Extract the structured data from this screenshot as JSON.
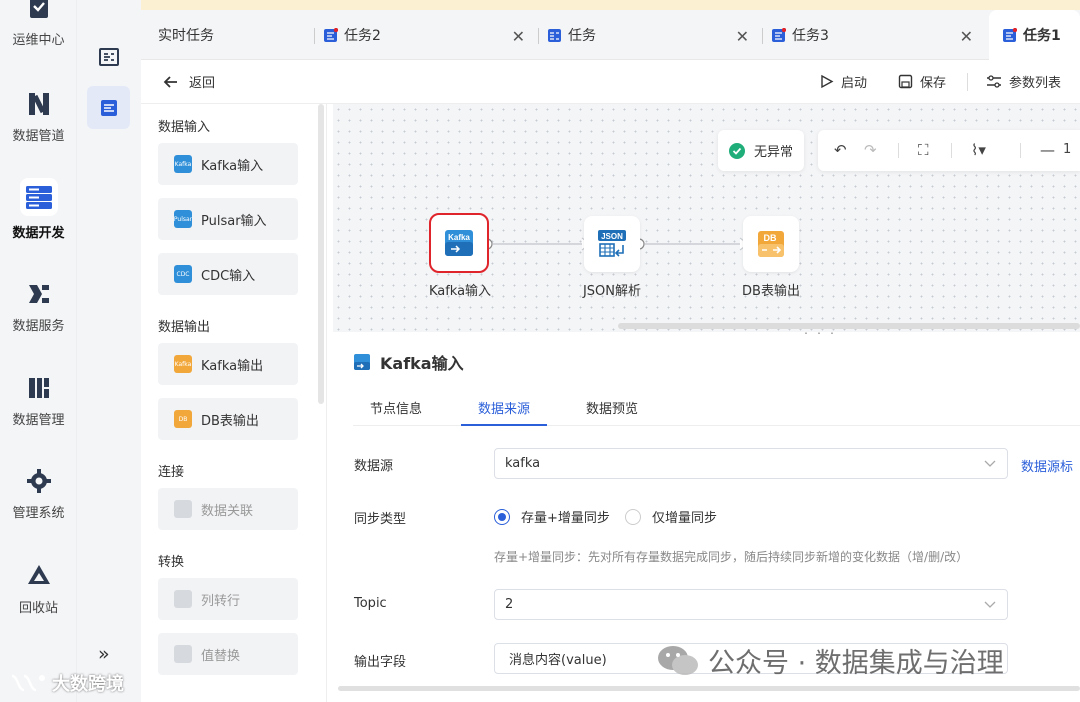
{
  "colors": {
    "accent": "#2b5fd9",
    "selected_outline": "#e0242b",
    "success": "#1fae7a",
    "kafka_icon": "#2f8fd8",
    "db_icon": "#f2a73a"
  },
  "nav": {
    "items": [
      {
        "label": "运维中心",
        "icon": "ops-center-icon"
      },
      {
        "label": "数据管道",
        "icon": "data-pipeline-icon"
      },
      {
        "label": "数据开发",
        "icon": "data-dev-icon",
        "active": true
      },
      {
        "label": "数据服务",
        "icon": "data-service-icon"
      },
      {
        "label": "数据管理",
        "icon": "data-management-icon"
      },
      {
        "label": "管理系统",
        "icon": "gear-icon"
      },
      {
        "label": "回收站",
        "icon": "recycle-bin-icon"
      }
    ],
    "collapse_glyph": "»"
  },
  "tabs": {
    "items": [
      {
        "label": "实时任务"
      },
      {
        "label": "任务2",
        "closable": true
      },
      {
        "label": "任务",
        "closable": true
      },
      {
        "label": "任务3",
        "closable": true
      },
      {
        "label": "任务1",
        "active": true
      }
    ]
  },
  "toolbar": {
    "back": "返回",
    "start": "启动",
    "save": "保存",
    "params": "参数列表"
  },
  "palette": {
    "groups": [
      {
        "title": "数据输入",
        "items": [
          {
            "label": "Kafka输入"
          },
          {
            "label": "Pulsar输入"
          },
          {
            "label": "CDC输入"
          }
        ]
      },
      {
        "title": "数据输出",
        "items": [
          {
            "label": "Kafka输出"
          },
          {
            "label": "DB表输出"
          }
        ]
      },
      {
        "title": "连接",
        "items": [
          {
            "label": "数据关联",
            "disabled": true
          }
        ]
      },
      {
        "title": "转换",
        "items": [
          {
            "label": "列转行",
            "disabled": true
          },
          {
            "label": "值替换",
            "disabled": true
          }
        ]
      }
    ],
    "icon_text": {
      "kafka": "Kafka",
      "pulsar": "Pulsar",
      "cdc": "CDC",
      "db": "DB"
    }
  },
  "canvas": {
    "status": "无异常",
    "zoom_label": "1",
    "nodes": [
      {
        "label": "Kafka输入",
        "icon": "kafka-icon",
        "badge": "Kafka",
        "selected": true
      },
      {
        "label": "JSON解析",
        "icon": "json-icon",
        "badge": "JSON"
      },
      {
        "label": "DB表输出",
        "icon": "db-icon",
        "badge": "DB"
      }
    ]
  },
  "detail": {
    "title": "Kafka输入",
    "tabs": [
      {
        "label": "节点信息"
      },
      {
        "label": "数据来源",
        "active": true
      },
      {
        "label": "数据预览"
      }
    ],
    "form": {
      "datasource_label": "数据源",
      "datasource_value": "kafka",
      "datasource_link": "数据源标",
      "sync_label": "同步类型",
      "sync_options": [
        {
          "label": "存量+增量同步",
          "checked": true
        },
        {
          "label": "仅增量同步",
          "checked": false
        }
      ],
      "sync_hint": "存量+增量同步：先对所有存量数据完成同步，随后持续同步新增的变化数据（增/删/改）",
      "topic_label": "Topic",
      "topic_value": "2",
      "output_label": "输出字段",
      "output_value": "消息内容(value)"
    }
  },
  "watermark": {
    "text": "公众号 · 数据集成与治理",
    "left_text": "大数跨境"
  }
}
